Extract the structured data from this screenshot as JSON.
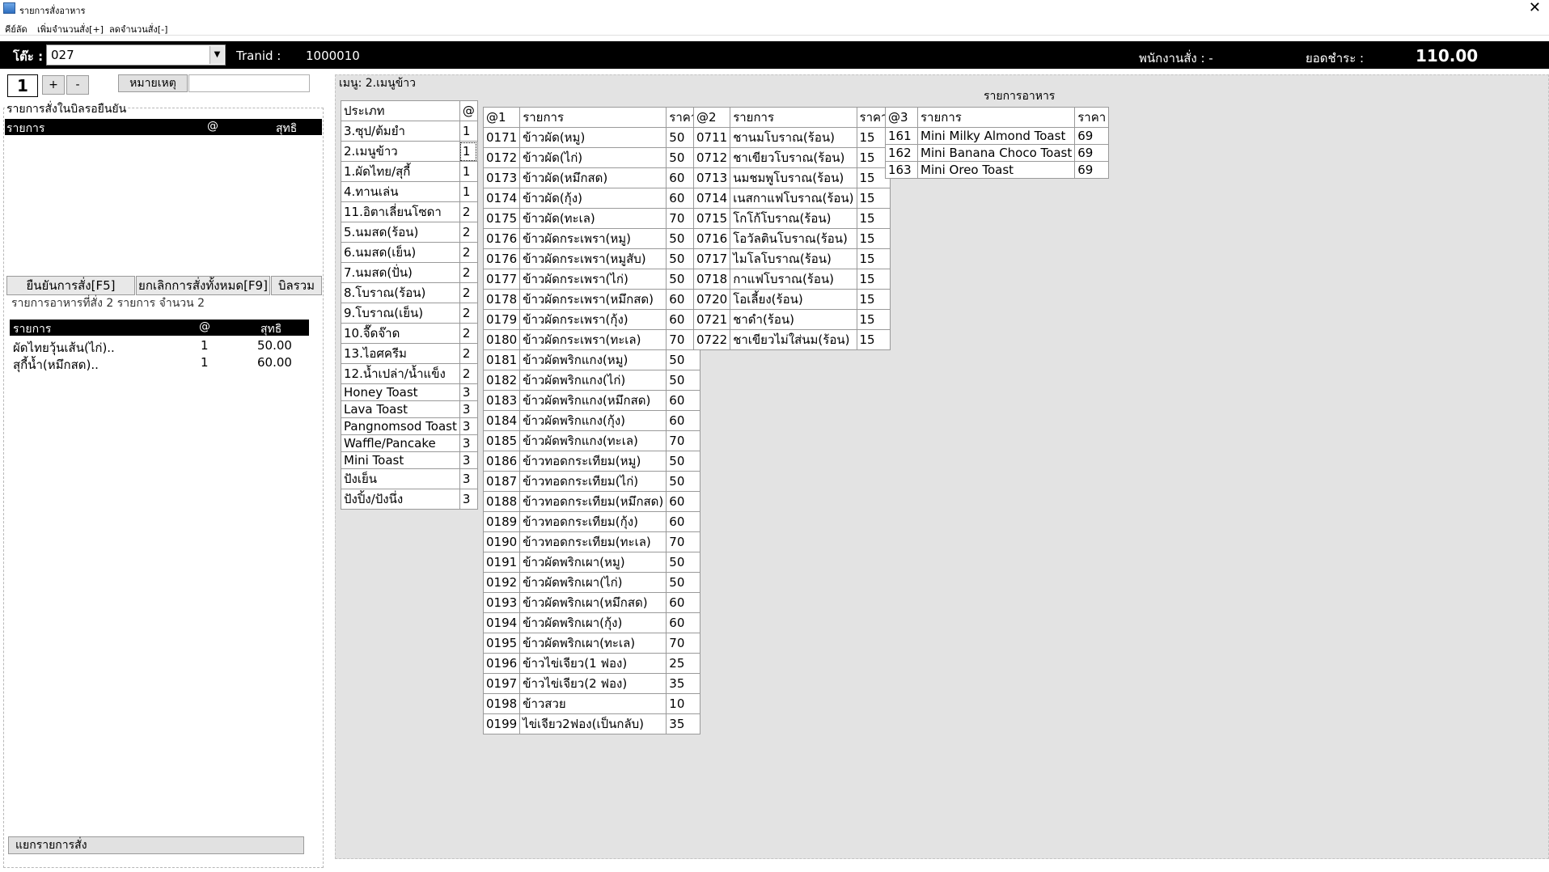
{
  "window": {
    "title": "รายการสั่งอาหาร",
    "close_glyph": "✕"
  },
  "menubar": {
    "items": [
      "คีย์ลัด",
      "เพิ่มจำนวนสั่ง[+]",
      "ลดจำนวนสั่ง[-]"
    ]
  },
  "header": {
    "table_label": "โต๊ะ :",
    "table_value": "027",
    "tranid_label": "Tranid :",
    "tranid_value": "1000010",
    "staff_label": "พนักงานสั่ง : -",
    "total_label": "ยอดชำระ :",
    "total_value": "110.00"
  },
  "controls": {
    "qty": "1",
    "plus_label": "+",
    "minus_label": "-",
    "note_label": "หมายเหตุ",
    "note_value": ""
  },
  "pending": {
    "group_title": "รายการสั่งในบิลรอยืนยัน",
    "columns": [
      "รายการ",
      "@",
      "สุทธิ"
    ]
  },
  "actions": {
    "confirm_label": "ยืนยันการสั่ง[F5]",
    "cancel_all_label": "ยกเลิกการสั่งทั้งหมด[F9]",
    "bill_total_label": "บิลรวม",
    "split_label": "แยกรายการสั่ง"
  },
  "ordered": {
    "summary": "รายการอาหารที่สั่ง  2 รายการ     จำนวน  2",
    "columns": [
      "รายการ",
      "@",
      "สุทธิ"
    ],
    "rows": [
      {
        "item": "ผัดไทยวุ้นเส้น(ไก่)..",
        "qty": "1",
        "net": "50.00"
      },
      {
        "item": "สุกี้น้ำ(หมึกสด)..",
        "qty": "1",
        "net": "60.00"
      }
    ]
  },
  "menu_label": "เมนู: 2.เมนูข้าว",
  "food_title": "รายการอาหาร",
  "categories": {
    "columns": [
      "ประเภท",
      "@"
    ],
    "rows": [
      [
        "3.ซุป/ต้มยำ",
        "1"
      ],
      [
        "2.เมนูข้าว",
        "1"
      ],
      [
        "1.ผัดไทย/สุกี้",
        "1"
      ],
      [
        "4.ทานเล่น",
        "1"
      ],
      [
        "11.อิตาเลี่ยนโซดา",
        "2"
      ],
      [
        "5.นมสด(ร้อน)",
        "2"
      ],
      [
        "6.นมสด(เย็น)",
        "2"
      ],
      [
        "7.นมสด(ปั่น)",
        "2"
      ],
      [
        "8.โบราณ(ร้อน)",
        "2"
      ],
      [
        "9.โบราณ(เย็น)",
        "2"
      ],
      [
        "10.จื๊ดจ๊าด",
        "2"
      ],
      [
        "13.ไอศครีม",
        "2"
      ],
      [
        "12.น้ำเปล่า/น้ำแข็ง",
        "2"
      ],
      [
        "Honey Toast",
        "3"
      ],
      [
        "Lava Toast",
        "3"
      ],
      [
        "Pangnomsod Toast",
        "3"
      ],
      [
        "Waffle/Pancake",
        "3"
      ],
      [
        "Mini Toast",
        "3"
      ],
      [
        "ปังเย็น",
        "3"
      ],
      [
        "ปังปิ้ง/ปังนึ่ง",
        "3"
      ]
    ]
  },
  "food1": {
    "columns": [
      "@1",
      "รายการ",
      "ราคา"
    ],
    "rows": [
      [
        "0171",
        "ข้าวผัด(หมู)",
        "50"
      ],
      [
        "0172",
        "ข้าวผัด(ไก่)",
        "50"
      ],
      [
        "0173",
        "ข้าวผัด(หมึกสด)",
        "60"
      ],
      [
        "0174",
        "ข้าวผัด(กุ้ง)",
        "60"
      ],
      [
        "0175",
        "ข้าวผัด(ทะเล)",
        "70"
      ],
      [
        "0176",
        "ข้าวผัดกระเพรา(หมู)",
        "50"
      ],
      [
        "0176",
        "ข้าวผัดกระเพรา(หมูสับ)",
        "50"
      ],
      [
        "0177",
        "ข้าวผัดกระเพรา(ไก่)",
        "50"
      ],
      [
        "0178",
        "ข้าวผัดกระเพรา(หมึกสด)",
        "60"
      ],
      [
        "0179",
        "ข้าวผัดกระเพรา(กุ้ง)",
        "60"
      ],
      [
        "0180",
        "ข้าวผัดกระเพรา(ทะเล)",
        "70"
      ],
      [
        "0181",
        "ข้าวผัดพริกแกง(หมู)",
        "50"
      ],
      [
        "0182",
        "ข้าวผัดพริกแกง(ไก่)",
        "50"
      ],
      [
        "0183",
        "ข้าวผัดพริกแกง(หมึกสด)",
        "60"
      ],
      [
        "0184",
        "ข้าวผัดพริกแกง(กุ้ง)",
        "60"
      ],
      [
        "0185",
        "ข้าวผัดพริกแกง(ทะเล)",
        "70"
      ],
      [
        "0186",
        "ข้าวทอดกระเทียม(หมู)",
        "50"
      ],
      [
        "0187",
        "ข้าวทอดกระเทียม(ไก่)",
        "50"
      ],
      [
        "0188",
        "ข้าวทอดกระเทียม(หมึกสด)",
        "60"
      ],
      [
        "0189",
        "ข้าวทอดกระเทียม(กุ้ง)",
        "60"
      ],
      [
        "0190",
        "ข้าวทอดกระเทียม(ทะเล)",
        "70"
      ],
      [
        "0191",
        "ข้าวผัดพริกเผา(หมู)",
        "50"
      ],
      [
        "0192",
        "ข้าวผัดพริกเผา(ไก่)",
        "50"
      ],
      [
        "0193",
        "ข้าวผัดพริกเผา(หมึกสด)",
        "60"
      ],
      [
        "0194",
        "ข้าวผัดพริกเผา(กุ้ง)",
        "60"
      ],
      [
        "0195",
        "ข้าวผัดพริกเผา(ทะเล)",
        "70"
      ],
      [
        "0196",
        "ข้าวไข่เจียว(1 ฟอง)",
        "25"
      ],
      [
        "0197",
        "ข้าวไข่เจียว(2 ฟอง)",
        "35"
      ],
      [
        "0198",
        "ข้าวสวย",
        "10"
      ],
      [
        "0199",
        "ไข่เจียว2ฟอง(เป็นกลับ)",
        "35"
      ]
    ]
  },
  "food2": {
    "columns": [
      "@2",
      "รายการ",
      "ราคา"
    ],
    "rows": [
      [
        "0711",
        "ชานมโบราณ(ร้อน)",
        "15"
      ],
      [
        "0712",
        "ชาเขียวโบราณ(ร้อน)",
        "15"
      ],
      [
        "0713",
        "นมชมพูโบราณ(ร้อน)",
        "15"
      ],
      [
        "0714",
        "เนสกาแฟโบราณ(ร้อน)",
        "15"
      ],
      [
        "0715",
        "โกโก้โบราณ(ร้อน)",
        "15"
      ],
      [
        "0716",
        "โอวัลตินโบราณ(ร้อน)",
        "15"
      ],
      [
        "0717",
        "ไมโลโบราณ(ร้อน)",
        "15"
      ],
      [
        "0718",
        "กาแฟโบราณ(ร้อน)",
        "15"
      ],
      [
        "0720",
        "โอเลี้ยง(ร้อน)",
        "15"
      ],
      [
        "0721",
        "ชาดำ(ร้อน)",
        "15"
      ],
      [
        "0722",
        "ชาเขียวไม่ใส่นม(ร้อน)",
        "15"
      ]
    ]
  },
  "food3": {
    "columns": [
      "@3",
      "รายการ",
      "ราคา"
    ],
    "rows": [
      [
        "161",
        "Mini Milky Almond Toast",
        "69"
      ],
      [
        "162",
        "Mini Banana Choco Toast",
        "69"
      ],
      [
        "163",
        "Mini Oreo Toast",
        "69"
      ]
    ]
  }
}
